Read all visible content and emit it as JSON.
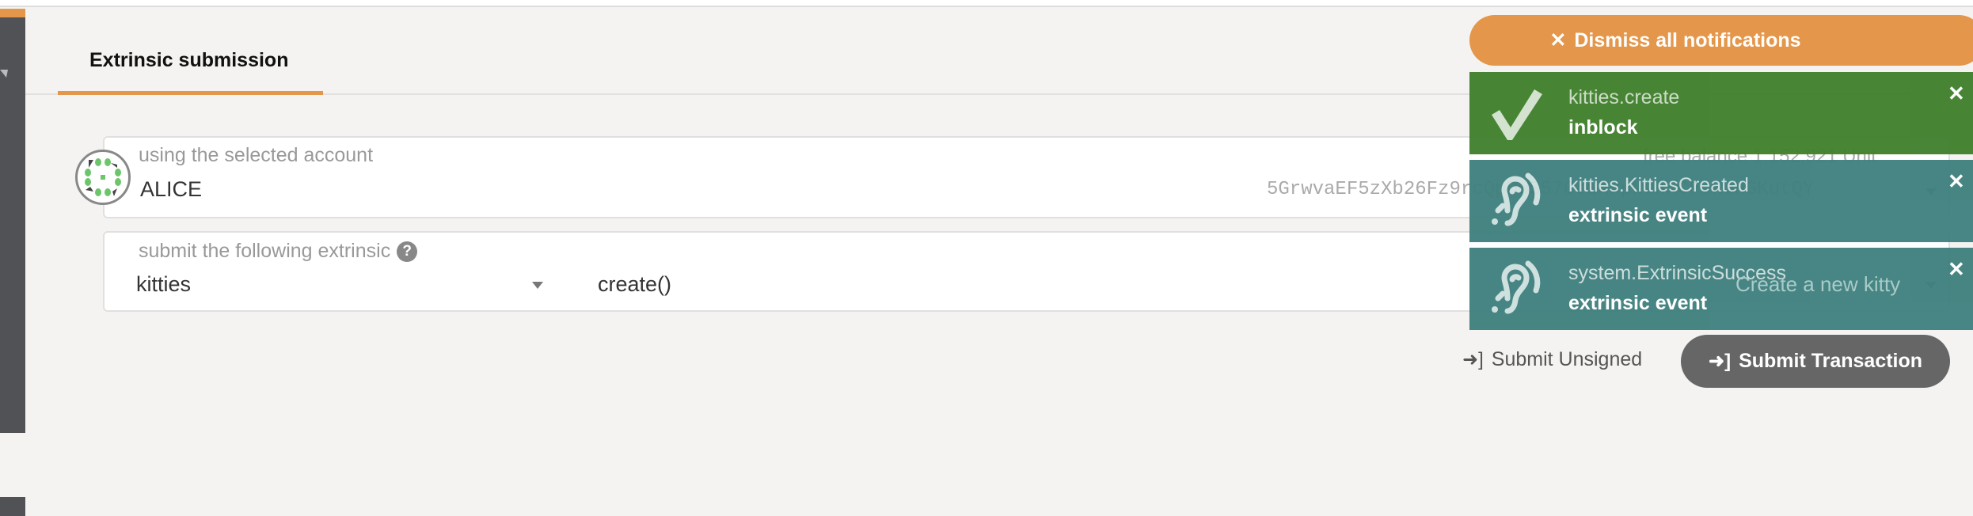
{
  "tab": {
    "label": "Extrinsic submission"
  },
  "account": {
    "label": "using the selected account",
    "name": "ALICE",
    "address": "5GrwvaEF5zXb26Fz9rcQpDWS57CtERHpNehXCPcNoHGKutQY",
    "balance": "free balance 1,152,921 Unit"
  },
  "extrinsic": {
    "label": "submit the following extrinsic",
    "help_icon": "?",
    "module": "kitties",
    "method": "create()",
    "doc": "Create a new kitty"
  },
  "actions": {
    "unsigned": "Submit Unsigned",
    "submit": "Submit Transaction"
  },
  "notifications": {
    "dismiss_all": "Dismiss all notifications",
    "items": [
      {
        "title": "kitties.create",
        "status": "inblock",
        "icon": "check-icon",
        "color": "#41812e"
      },
      {
        "title": "kitties.KittiesCreated",
        "status": "extrinsic event",
        "icon": "ear-icon",
        "color": "#40817f"
      },
      {
        "title": "system.ExtrinsicSuccess",
        "status": "extrinsic event",
        "icon": "ear-icon",
        "color": "#40817f"
      }
    ]
  },
  "colors": {
    "accent": "#e4964a",
    "success": "#41812e",
    "event": "#40817f"
  }
}
